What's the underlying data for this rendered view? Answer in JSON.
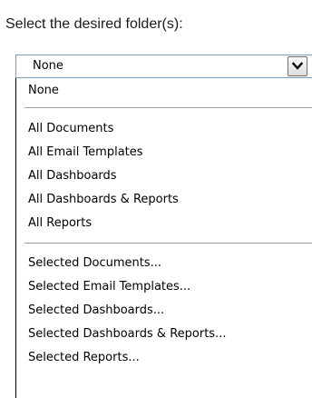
{
  "prompt": "Select the desired folder(s):",
  "select": {
    "value": "None",
    "button_icon": "chevron-down-icon"
  },
  "options": {
    "none": "None",
    "group_all": [
      "All Documents",
      "All Email Templates",
      "All Dashboards",
      "All Dashboards & Reports",
      "All Reports"
    ],
    "group_selected": [
      "Selected Documents...",
      "Selected Email Templates...",
      "Selected Dashboards...",
      "Selected Dashboards & Reports...",
      "Selected Reports..."
    ]
  },
  "colors": {
    "border": "#7f9db9",
    "separator": "#a0a0a0"
  }
}
